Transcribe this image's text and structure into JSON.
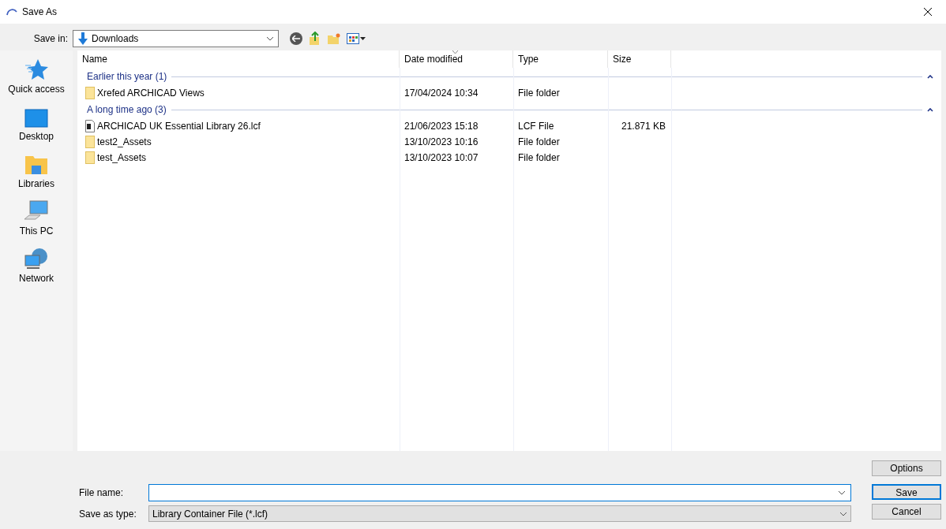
{
  "window": {
    "title": "Save As"
  },
  "save_in": {
    "label": "Save in:",
    "value": "Downloads"
  },
  "sidebar": {
    "items": [
      {
        "label": "Quick access",
        "kind": "star"
      },
      {
        "label": "Desktop",
        "kind": "desktop"
      },
      {
        "label": "Libraries",
        "kind": "libraries"
      },
      {
        "label": "This PC",
        "kind": "pc"
      },
      {
        "label": "Network",
        "kind": "network"
      }
    ]
  },
  "table": {
    "columns": [
      {
        "label": "Name",
        "sorted": false
      },
      {
        "label": "Date modified",
        "sorted": true
      },
      {
        "label": "Type",
        "sorted": false
      },
      {
        "label": "Size",
        "sorted": false
      }
    ],
    "groups": [
      {
        "label": "Earlier this year (1)",
        "expanded": true,
        "rows": [
          {
            "kind": "folder",
            "name": "Xrefed ARCHICAD Views",
            "date": "17/04/2024 10:34",
            "type": "File folder"
          }
        ]
      },
      {
        "label": "A long time ago (3)",
        "expanded": true,
        "rows": [
          {
            "kind": "lcf",
            "name": "ARCHICAD UK Essential Library 26.lcf",
            "date": "21/06/2023 15:18",
            "type": "LCF File",
            "size": "21.871 KB"
          },
          {
            "kind": "folder",
            "name": "test2_Assets",
            "date": "13/10/2023 10:16",
            "type": "File folder"
          },
          {
            "kind": "folder",
            "name": "test_Assets",
            "date": "13/10/2023 10:07",
            "type": "File folder"
          }
        ]
      }
    ]
  },
  "file_name": {
    "label": "File name:",
    "focused": true
  },
  "save_as_type": {
    "label": "Save as type:",
    "value": "Library Container File (*.lcf)"
  },
  "buttons": [
    {
      "label": "Options",
      "default": false
    },
    {
      "label": "Save",
      "default": true
    },
    {
      "label": "Cancel",
      "default": false
    }
  ]
}
